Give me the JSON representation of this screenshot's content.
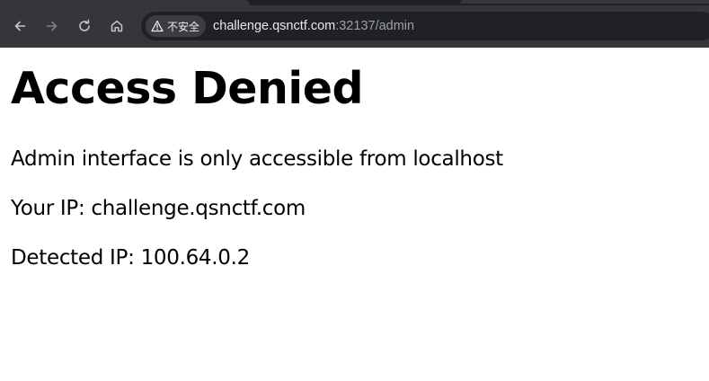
{
  "browser": {
    "nav": {
      "back_icon": "arrow-left-icon",
      "forward_icon": "arrow-right-icon",
      "reload_icon": "reload-icon",
      "home_icon": "home-icon"
    },
    "address_bar": {
      "security_icon": "warning-triangle-icon",
      "security_label": "不安全",
      "url_host": "challenge.qsnctf.com",
      "url_rest": ":32137/admin"
    },
    "colors": {
      "chrome": "#35363a",
      "omnibox": "#202124",
      "text": "#e8eaed",
      "muted_text": "#9aa0a6"
    }
  },
  "page": {
    "title": "Access Denied",
    "lines": [
      "Admin interface is only accessible from localhost",
      "Your IP: challenge.qsnctf.com",
      "Detected IP: 100.64.0.2"
    ]
  }
}
